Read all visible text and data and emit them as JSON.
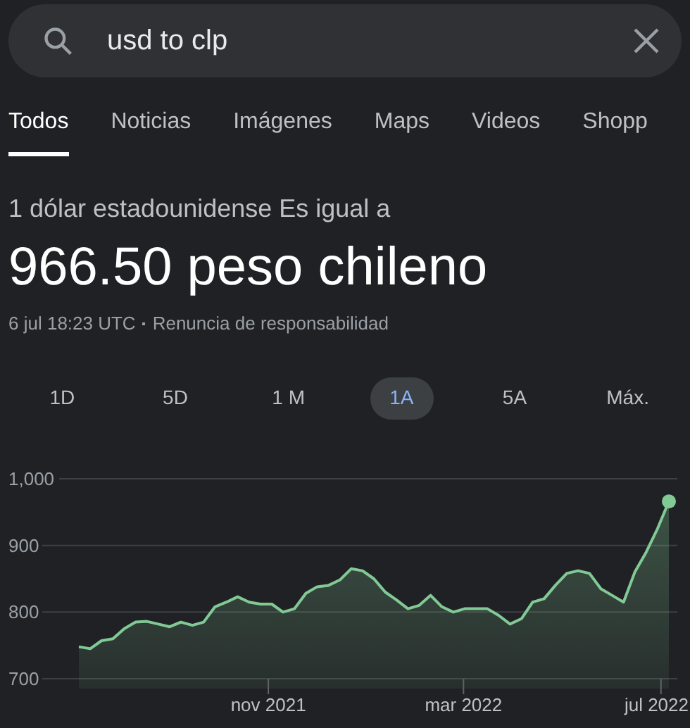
{
  "search": {
    "value": "usd to clp"
  },
  "tabs": [
    {
      "label": "Todos",
      "selected": true
    },
    {
      "label": "Noticias",
      "selected": false
    },
    {
      "label": "Imágenes",
      "selected": false
    },
    {
      "label": "Maps",
      "selected": false
    },
    {
      "label": "Videos",
      "selected": false
    },
    {
      "label": "Shopp",
      "selected": false
    }
  ],
  "converter": {
    "prefix": "1 dólar estadounidense Es igual a",
    "result": "966.50 peso chileno",
    "timestamp": "6 jul 18:23 UTC",
    "disclaimer": "Renuncia de responsabilidad"
  },
  "ranges": [
    {
      "label": "1D",
      "selected": false
    },
    {
      "label": "5D",
      "selected": false
    },
    {
      "label": "1 M",
      "selected": false
    },
    {
      "label": "1A",
      "selected": true
    },
    {
      "label": "5A",
      "selected": false
    },
    {
      "label": "Máx.",
      "selected": false
    }
  ],
  "chart_data": {
    "type": "area",
    "ylim": [
      700,
      1000
    ],
    "yticks": [
      {
        "value": 1000,
        "label": "1,000"
      },
      {
        "value": 900,
        "label": "900"
      },
      {
        "value": 800,
        "label": "800"
      },
      {
        "value": 700,
        "label": "700"
      }
    ],
    "series": [
      {
        "color": "#81c995",
        "values": [
          748,
          745,
          757,
          760,
          775,
          785,
          786,
          782,
          778,
          785,
          780,
          785,
          808,
          815,
          823,
          815,
          812,
          812,
          800,
          805,
          828,
          838,
          840,
          848,
          865,
          862,
          850,
          830,
          818,
          805,
          810,
          825,
          808,
          800,
          805,
          805,
          805,
          795,
          782,
          790,
          815,
          820,
          840,
          858,
          862,
          858,
          835,
          825,
          815,
          860,
          890,
          925,
          966
        ]
      }
    ]
  },
  "x_axis_labels": [
    "nov 2021",
    "mar 2022",
    "jul 2022"
  ]
}
